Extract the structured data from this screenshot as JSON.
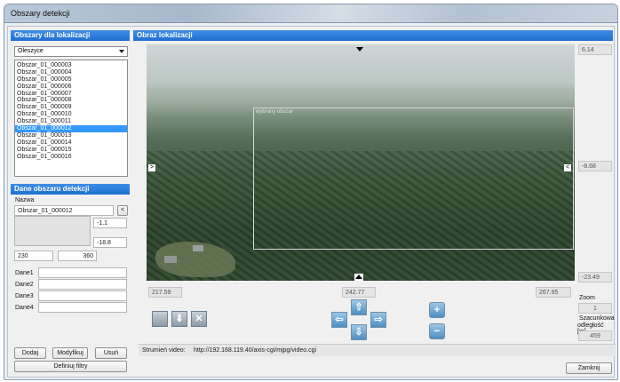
{
  "window": {
    "title": "Obszary detekcji"
  },
  "left_panel": {
    "header": "Obszary dla lokalizacji",
    "location_select": "Oleszyce",
    "areas": [
      "Obszar_01_000003",
      "Obszar_01_000004",
      "Obszar_01_000005",
      "Obszar_01_000006",
      "Obszar_01_000007",
      "Obszar_01_000008",
      "Obszar_01_000009",
      "Obszar_01_000010",
      "Obszar_01_000011",
      "Obszar_01_000012",
      "Obszar_01_000013",
      "Obszar_01_000014",
      "Obszar_01_000015",
      "Obszar_01_000016"
    ],
    "selected_area": "Obszar_01_000012"
  },
  "area_data": {
    "header": "Dane obszaru detekcji",
    "name_label": "Nazwa",
    "name_value": "Obszar_01_000012",
    "name_button": "<",
    "value_top": "-1.1",
    "value_bottom": "-18.8",
    "value_left": "230",
    "value_right": "360",
    "dane_labels": [
      "Dane1",
      "Dane2",
      "Dane3",
      "Dane4"
    ],
    "buttons": {
      "add": "Dodaj",
      "modify": "Modyfikuj",
      "delete": "Usuń",
      "filters": "Definiuj filtry"
    }
  },
  "view": {
    "header": "Obraz lokalizacji",
    "selection_label": "wybrany obszar",
    "right_top": "6.14",
    "right_mid": "-8.68",
    "right_bottom": "-23.49",
    "bottom_left": "217.59",
    "bottom_mid": "242.77",
    "bottom_right": "267.95",
    "marker_left": ">",
    "marker_right": "<",
    "zoom_label": "Zoom",
    "zoom_value": "1",
    "distance_label_1": "Szacunkowa",
    "distance_label_2": "odległość [m]",
    "distance_value": "459"
  },
  "controls": {
    "arrows": {
      "up": "⇧",
      "down": "⇩",
      "left": "⇦",
      "right": "⇨"
    },
    "zoom_in": "+",
    "zoom_out": "−",
    "tools": {
      "square": "",
      "save": "⬇",
      "clear": "✕"
    }
  },
  "stream": {
    "label": "Strumień video:",
    "url": "http://192.168.119.40/axis-cgi/mjpg/video.cgi"
  },
  "footer": {
    "close": "Zamknij"
  }
}
